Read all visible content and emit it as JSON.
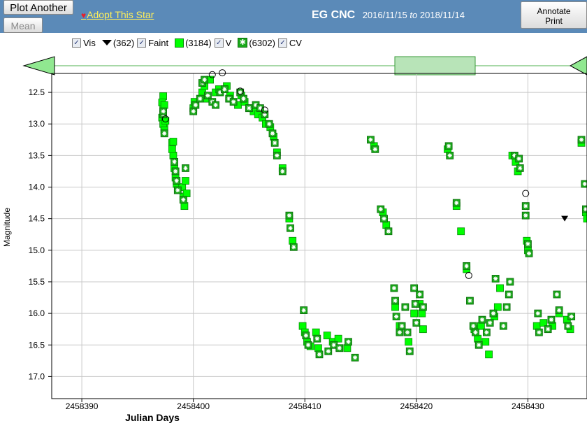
{
  "toolbar": {
    "plot_another_label": "Plot Another",
    "mean_label": "Mean",
    "adopt_label": "Adopt This Star",
    "annotate_label": "Annotate",
    "print_label": "Print"
  },
  "header": {
    "star_name": "EG CNC",
    "date_from": "2016/11/15",
    "date_to_word": "to",
    "date_to": "2018/11/14"
  },
  "legend": {
    "vis": {
      "label": "Vis",
      "checked": true
    },
    "faint": {
      "count": "(362)",
      "label": "Faint",
      "checked": true
    },
    "v": {
      "count": "(3184)",
      "label": "V",
      "checked": true
    },
    "cv": {
      "count": "(6302)",
      "label": "CV",
      "checked": true
    }
  },
  "colors": {
    "toolbar_bg": "#5b8ab8",
    "v_fill": "#00ff00",
    "cv_fill": "#1aa81a",
    "adopt_link": "#ffef5a",
    "slider_window": "#a8e0a8"
  },
  "icons": {
    "heart": "heart-icon",
    "checkbox": "checkbox-icon",
    "faint_marker": "triangle-down-icon",
    "v_marker": "green-square-icon",
    "cv_marker": "starred-square-icon",
    "pan_left": "pan-left-arrow-icon",
    "pan_right": "pan-right-arrow-icon"
  },
  "chart_data": {
    "type": "scatter",
    "xlabel": "Julian Days",
    "ylabel": "Magnitude",
    "xlim": [
      2458387.3,
      2458435.3
    ],
    "ylim": [
      17.35,
      12.2
    ],
    "y_inverted": true,
    "grid": true,
    "x_ticks": [
      2458390,
      2458400,
      2458410,
      2458420,
      2458430
    ],
    "x_tick_labels": [
      "2458390",
      "2458400",
      "2458410",
      "2458420",
      "2458430"
    ],
    "y_ticks": [
      12.5,
      13.0,
      13.5,
      14.0,
      14.5,
      15.0,
      15.5,
      16.0,
      16.5,
      17.0
    ],
    "y_tick_labels": [
      "12.5",
      "13.0",
      "13.5",
      "14.0",
      "14.5",
      "15.0",
      "15.5",
      "16.0",
      "16.5",
      "17.0"
    ],
    "series": [
      {
        "name": "V",
        "marker": "square",
        "points": [
          [
            2458397.3,
            12.56
          ],
          [
            2458397.2,
            12.9
          ],
          [
            2458397.4,
            13.05
          ],
          [
            2458397.3,
            12.75
          ],
          [
            2458397.2,
            12.66
          ],
          [
            2458397.4,
            12.7
          ],
          [
            2458397.3,
            13.0
          ],
          [
            2458397.4,
            13.1
          ],
          [
            2458397.5,
            12.95
          ],
          [
            2458398.1,
            13.3
          ],
          [
            2458398.2,
            13.5
          ],
          [
            2458398.1,
            13.4
          ],
          [
            2458398.3,
            13.7
          ],
          [
            2458398.4,
            13.85
          ],
          [
            2458398.5,
            13.95
          ],
          [
            2458399.0,
            14.0
          ],
          [
            2458399.1,
            14.15
          ],
          [
            2458399.2,
            14.3
          ],
          [
            2458399.3,
            13.9
          ],
          [
            2458399.4,
            14.1
          ],
          [
            2458398.2,
            13.28
          ],
          [
            2458400.0,
            12.75
          ],
          [
            2458400.1,
            12.65
          ],
          [
            2458400.8,
            12.5
          ],
          [
            2458401.0,
            12.4
          ],
          [
            2458401.2,
            12.6
          ],
          [
            2458401.5,
            12.3
          ],
          [
            2458402.0,
            12.5
          ],
          [
            2458402.3,
            12.45
          ],
          [
            2458403.0,
            12.4
          ],
          [
            2458403.3,
            12.55
          ],
          [
            2458404.0,
            12.7
          ],
          [
            2458404.3,
            12.55
          ],
          [
            2458404.6,
            12.65
          ],
          [
            2458405.0,
            12.75
          ],
          [
            2458405.4,
            12.8
          ],
          [
            2458405.8,
            12.85
          ],
          [
            2458406.2,
            12.9
          ],
          [
            2458406.5,
            13.0
          ],
          [
            2458406.9,
            13.05
          ],
          [
            2458407.2,
            13.2
          ],
          [
            2458407.5,
            13.45
          ],
          [
            2458408.0,
            13.7
          ],
          [
            2458408.6,
            14.5
          ],
          [
            2458408.9,
            14.85
          ],
          [
            2458409.8,
            16.2
          ],
          [
            2458410.0,
            16.3
          ],
          [
            2458410.2,
            16.45
          ],
          [
            2458410.5,
            16.52
          ],
          [
            2458411.0,
            16.3
          ],
          [
            2458411.2,
            16.55
          ],
          [
            2458412.0,
            16.35
          ],
          [
            2458412.5,
            16.45
          ],
          [
            2458413.0,
            16.4
          ],
          [
            2458413.8,
            16.55
          ],
          [
            2458416.2,
            13.35
          ],
          [
            2458417.0,
            14.4
          ],
          [
            2458417.3,
            14.6
          ],
          [
            2458418.1,
            15.9
          ],
          [
            2458418.5,
            16.2
          ],
          [
            2458419.3,
            16.45
          ],
          [
            2458419.8,
            16.0
          ],
          [
            2458420.3,
            15.85
          ],
          [
            2458420.5,
            16.0
          ],
          [
            2458420.6,
            16.25
          ],
          [
            2458422.8,
            13.4
          ],
          [
            2458423.6,
            14.3
          ],
          [
            2458424.0,
            14.7
          ],
          [
            2458424.5,
            15.3
          ],
          [
            2458425.2,
            16.25
          ],
          [
            2458425.5,
            16.4
          ],
          [
            2458425.8,
            16.2
          ],
          [
            2458426.2,
            16.45
          ],
          [
            2458426.5,
            16.65
          ],
          [
            2458427.0,
            16.05
          ],
          [
            2458427.3,
            15.9
          ],
          [
            2458427.5,
            15.6
          ],
          [
            2458428.6,
            13.5
          ],
          [
            2458428.9,
            13.6
          ],
          [
            2458429.1,
            13.75
          ],
          [
            2458429.9,
            14.85
          ],
          [
            2458430.0,
            15.0
          ],
          [
            2458430.8,
            16.2
          ],
          [
            2458431.4,
            16.15
          ],
          [
            2458432.2,
            16.2
          ],
          [
            2458432.8,
            16.0
          ],
          [
            2458433.5,
            16.1
          ],
          [
            2458433.8,
            16.25
          ],
          [
            2458434.8,
            13.3
          ],
          [
            2458435.2,
            14.4
          ],
          [
            2458435.3,
            14.5
          ]
        ]
      },
      {
        "name": "CV",
        "marker": "starred-square",
        "points": [
          [
            2458397.3,
            12.85
          ],
          [
            2458397.4,
            13.15
          ],
          [
            2458397.3,
            12.8
          ],
          [
            2458398.3,
            13.6
          ],
          [
            2458398.4,
            13.75
          ],
          [
            2458398.5,
            13.9
          ],
          [
            2458398.6,
            14.05
          ],
          [
            2458399.1,
            14.2
          ],
          [
            2458399.3,
            13.7
          ],
          [
            2458400.0,
            12.8
          ],
          [
            2458400.2,
            12.7
          ],
          [
            2458400.6,
            12.6
          ],
          [
            2458400.8,
            12.35
          ],
          [
            2458401.0,
            12.3
          ],
          [
            2458401.3,
            12.55
          ],
          [
            2458401.7,
            12.65
          ],
          [
            2458402.0,
            12.7
          ],
          [
            2458402.4,
            12.5
          ],
          [
            2458402.8,
            12.45
          ],
          [
            2458403.2,
            12.6
          ],
          [
            2458403.6,
            12.65
          ],
          [
            2458404.2,
            12.5
          ],
          [
            2458404.5,
            12.6
          ],
          [
            2458405.0,
            12.75
          ],
          [
            2458405.6,
            12.7
          ],
          [
            2458406.0,
            12.75
          ],
          [
            2458406.4,
            12.85
          ],
          [
            2458406.8,
            13.0
          ],
          [
            2458407.1,
            13.15
          ],
          [
            2458407.3,
            13.3
          ],
          [
            2458407.5,
            13.5
          ],
          [
            2458408.0,
            13.75
          ],
          [
            2458408.6,
            14.45
          ],
          [
            2458408.7,
            14.65
          ],
          [
            2458409.0,
            14.95
          ],
          [
            2458409.9,
            15.95
          ],
          [
            2458410.1,
            16.35
          ],
          [
            2458410.3,
            16.5
          ],
          [
            2458411.1,
            16.4
          ],
          [
            2458411.3,
            16.65
          ],
          [
            2458412.1,
            16.6
          ],
          [
            2458412.6,
            16.5
          ],
          [
            2458413.1,
            16.55
          ],
          [
            2458413.9,
            16.45
          ],
          [
            2458414.5,
            16.7
          ],
          [
            2458415.9,
            13.25
          ],
          [
            2458416.3,
            13.4
          ],
          [
            2458416.8,
            14.35
          ],
          [
            2458417.1,
            14.5
          ],
          [
            2458417.5,
            14.7
          ],
          [
            2458418.0,
            15.6
          ],
          [
            2458418.1,
            15.8
          ],
          [
            2458418.2,
            16.05
          ],
          [
            2458418.5,
            16.3
          ],
          [
            2458418.7,
            16.2
          ],
          [
            2458419.0,
            15.9
          ],
          [
            2458419.2,
            16.3
          ],
          [
            2458419.4,
            16.6
          ],
          [
            2458419.8,
            15.6
          ],
          [
            2458419.9,
            15.85
          ],
          [
            2458420.0,
            16.15
          ],
          [
            2458420.3,
            15.7
          ],
          [
            2458420.6,
            15.9
          ],
          [
            2458422.9,
            13.35
          ],
          [
            2458423.0,
            13.5
          ],
          [
            2458423.6,
            14.25
          ],
          [
            2458424.5,
            15.25
          ],
          [
            2458424.8,
            15.8
          ],
          [
            2458425.1,
            16.2
          ],
          [
            2458425.3,
            16.3
          ],
          [
            2458425.6,
            16.5
          ],
          [
            2458425.9,
            16.1
          ],
          [
            2458426.3,
            16.3
          ],
          [
            2458426.6,
            16.15
          ],
          [
            2458426.9,
            16.0
          ],
          [
            2458427.1,
            15.45
          ],
          [
            2458427.8,
            16.2
          ],
          [
            2458428.1,
            15.9
          ],
          [
            2458428.3,
            15.7
          ],
          [
            2458428.4,
            15.5
          ],
          [
            2458428.8,
            13.5
          ],
          [
            2458429.2,
            13.55
          ],
          [
            2458429.3,
            13.7
          ],
          [
            2458429.8,
            14.3
          ],
          [
            2458429.8,
            14.45
          ],
          [
            2458430.0,
            14.9
          ],
          [
            2458430.1,
            15.05
          ],
          [
            2458430.9,
            16.0
          ],
          [
            2458431.0,
            16.3
          ],
          [
            2458431.8,
            16.25
          ],
          [
            2458432.1,
            16.1
          ],
          [
            2458432.6,
            15.7
          ],
          [
            2458432.8,
            15.95
          ],
          [
            2458433.6,
            16.2
          ],
          [
            2458433.9,
            16.05
          ],
          [
            2458434.8,
            13.25
          ],
          [
            2458435.1,
            13.95
          ],
          [
            2458435.2,
            14.35
          ]
        ]
      },
      {
        "name": "Vis",
        "marker": "open-circle",
        "points": [
          [
            2458397.5,
            12.92
          ],
          [
            2458401.7,
            12.22
          ],
          [
            2458402.6,
            12.19
          ],
          [
            2458404.2,
            12.48
          ],
          [
            2458406.4,
            12.78
          ],
          [
            2458424.7,
            15.4
          ],
          [
            2458429.8,
            14.1
          ]
        ]
      },
      {
        "name": "Faint",
        "marker": "triangle-down",
        "points": [
          [
            2458433.3,
            14.5
          ]
        ]
      }
    ]
  }
}
